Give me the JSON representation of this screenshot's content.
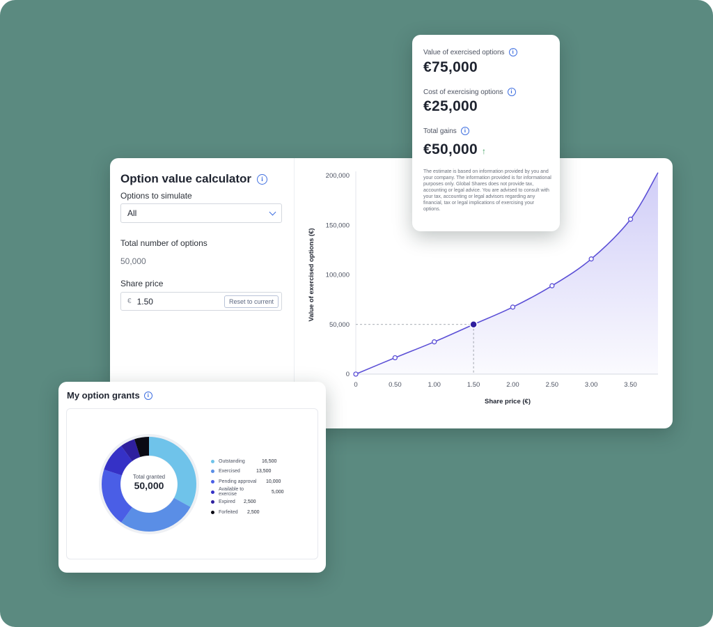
{
  "colors": {
    "background": "#5b8a80",
    "accent": "#3f6fe0",
    "line": "#5b4fd6",
    "positive": "#3a9d5d"
  },
  "calculator": {
    "title": "Option value calculator",
    "info_icon": "info-icon",
    "options_label": "Options to simulate",
    "options_selected": "All",
    "total_label": "Total number of options",
    "total_value": "50,000",
    "price_label": "Share price",
    "price_currency": "€",
    "price_value": "1.50",
    "reset_label": "Reset to current"
  },
  "summary": {
    "exercised_label": "Value of exercised options",
    "exercised_value": "€75,000",
    "cost_label": "Cost of exercising options",
    "cost_value": "€25,000",
    "gains_label": "Total gains",
    "gains_value": "€50,000",
    "gains_trend_icon": "arrow-up-icon",
    "disclaimer": "The estimate is based on information provided by you and your company. The information provided is for informational purposes only. Global Shares does not provide tax, accounting or legal advice. You are advised to consult with your tax, accounting or legal advisors regarding any financial, tax or legal implications of exercising your options."
  },
  "grants": {
    "title": "My option grants",
    "center_label": "Total granted",
    "center_value": "50,000",
    "legend": [
      {
        "label": "Outstanding",
        "value": "16,500",
        "color": "#6fc3ea"
      },
      {
        "label": "Exercised",
        "value": "13,500",
        "color": "#5a8ee6"
      },
      {
        "label": "Pending approval",
        "value": "10,000",
        "color": "#4a5ee6"
      },
      {
        "label": "Available to exercise",
        "value": "5,000",
        "color": "#3531c6"
      },
      {
        "label": "Expired",
        "value": "2,500",
        "color": "#2e1f9e"
      },
      {
        "label": "Forfeited",
        "value": "2,500",
        "color": "#0a0a14"
      }
    ]
  },
  "chart_data": {
    "type": "area",
    "xlabel": "Share price (€)",
    "ylabel": "Value of exercised options (€)",
    "x_ticks": [
      "0",
      "0.50",
      "1.00",
      "1.50",
      "2.00",
      "2.50",
      "3.00",
      "3.50"
    ],
    "y_ticks": [
      "0",
      "50,000",
      "100,000",
      "150,000",
      "200,000"
    ],
    "xlim": [
      0,
      3.85
    ],
    "ylim": [
      0,
      200000
    ],
    "series": [
      {
        "points": [
          [
            0,
            0
          ],
          [
            0.5,
            16500
          ],
          [
            1.0,
            32500
          ],
          [
            1.5,
            50000
          ],
          [
            2.0,
            67500
          ],
          [
            2.5,
            89000
          ],
          [
            3.0,
            116000
          ],
          [
            3.5,
            156000
          ],
          [
            3.85,
            203000
          ]
        ]
      }
    ],
    "highlight": {
      "x": 1.5,
      "y": 50000
    }
  }
}
